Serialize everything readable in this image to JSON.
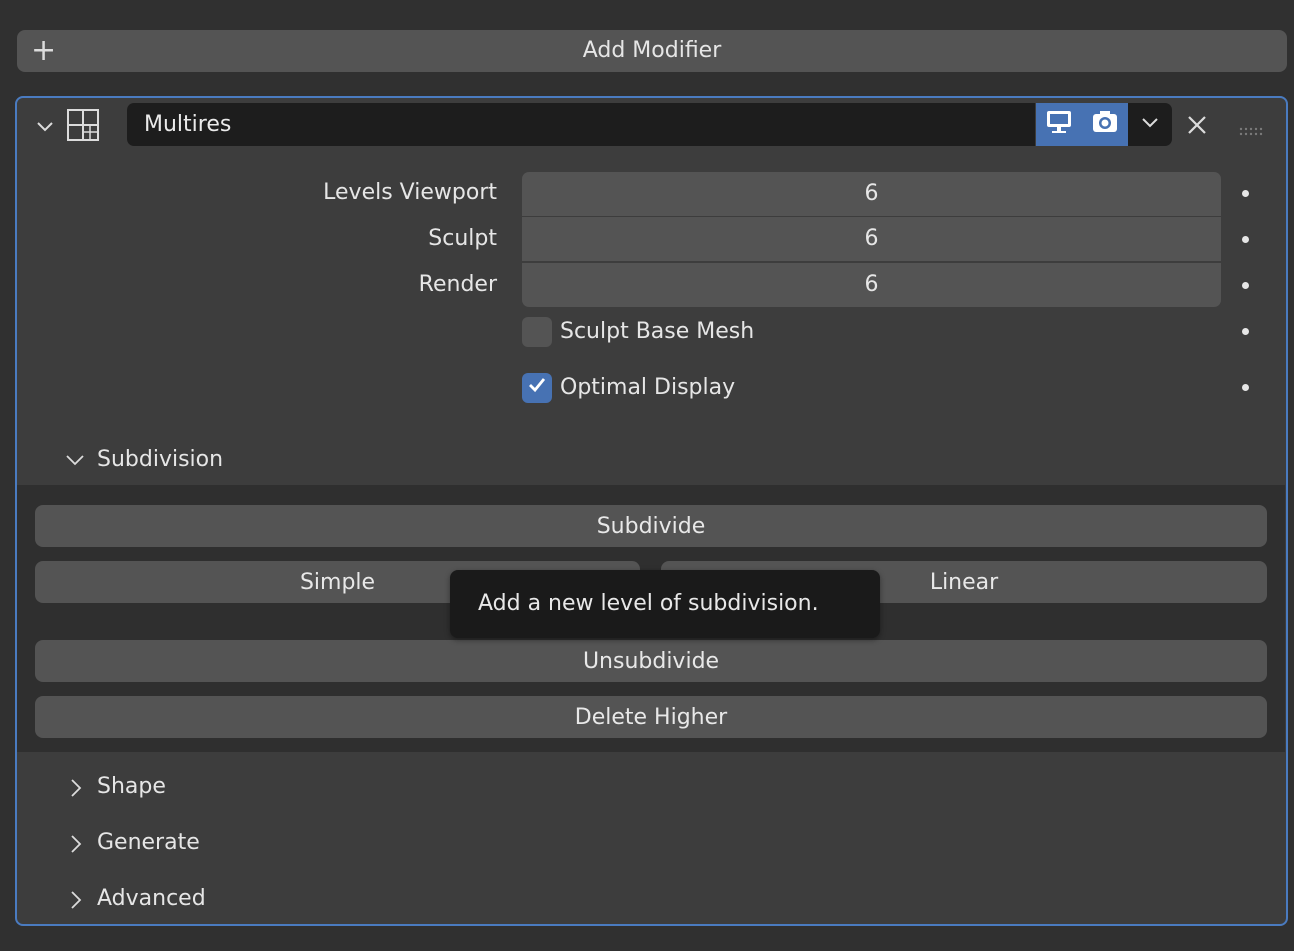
{
  "add_modifier": {
    "label": "Add Modifier",
    "icon": "plus-icon"
  },
  "modifier": {
    "name": "Multires",
    "type_icon": "multires-grid-icon",
    "show_viewport_icon": "monitor-icon",
    "show_render_icon": "camera-icon",
    "dropdown_icon": "chevron-down-icon",
    "remove_icon": "close-icon",
    "drag_icon": "drag-handle-icon"
  },
  "fields": {
    "levels_viewport": {
      "label": "Levels Viewport",
      "value": "6"
    },
    "sculpt": {
      "label": "Sculpt",
      "value": "6"
    },
    "render": {
      "label": "Render",
      "value": "6"
    }
  },
  "checkboxes": {
    "sculpt_base_mesh": {
      "label": "Sculpt Base Mesh",
      "checked": false
    },
    "optimal_display": {
      "label": "Optimal Display",
      "checked": true
    }
  },
  "subdivision": {
    "header": "Subdivision",
    "subdivide": "Subdivide",
    "simple": "Simple",
    "linear": "Linear",
    "unsubdivide": "Unsubdivide",
    "delete_higher": "Delete Higher"
  },
  "tooltip": "Add a new level of subdivision.",
  "collapsed_sections": {
    "shape": "Shape",
    "generate": "Generate",
    "advanced": "Advanced"
  },
  "colors": {
    "accent": "#4772b3",
    "panel_border": "#4a7bc0",
    "button": "#545454",
    "background": "#303030"
  }
}
